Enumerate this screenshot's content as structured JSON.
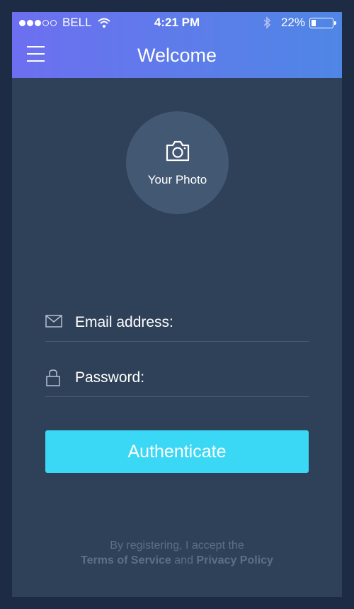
{
  "status_bar": {
    "carrier": "BELL",
    "time": "4:21 PM",
    "battery": "22%",
    "battery_level": 0.22,
    "signal_bars_filled": 3,
    "signal_bars_total": 5
  },
  "header": {
    "title": "Welcome",
    "menu_icon": "hamburger-menu-icon"
  },
  "photo": {
    "label": "Your Photo",
    "icon": "camera-icon"
  },
  "form": {
    "email_placeholder": "Email address:",
    "email_value": "",
    "email_icon": "envelope-icon",
    "password_placeholder": "Password:",
    "password_value": "",
    "password_icon": "lock-icon",
    "submit_label": "Authenticate"
  },
  "footer": {
    "prefix": "By registering, I accept the",
    "terms_link": "Terms of Service",
    "conjunction": "and",
    "privacy_link": "Privacy Policy"
  },
  "colors": {
    "header_gradient_start": "#6d6ff0",
    "header_gradient_end": "#4f86e6",
    "background": "#2f4159",
    "accent": "#3bd8f6"
  }
}
